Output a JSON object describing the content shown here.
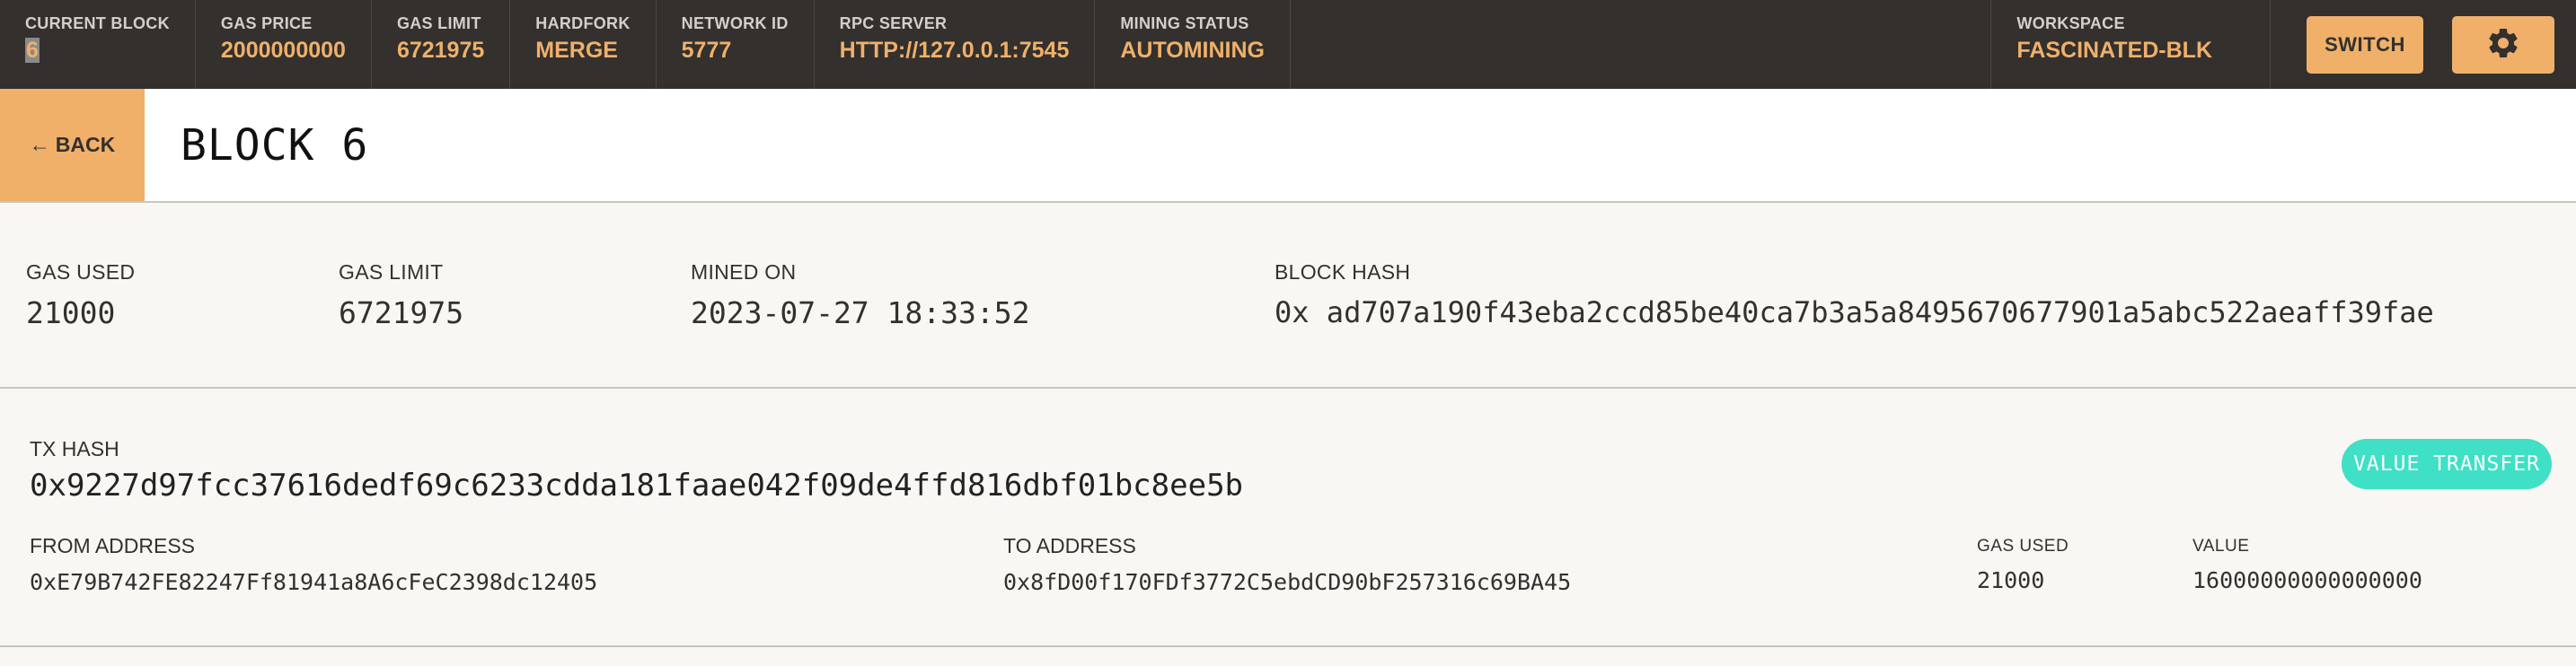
{
  "topbar": {
    "current_block": {
      "label": "CURRENT BLOCK",
      "value": "6"
    },
    "gas_price": {
      "label": "GAS PRICE",
      "value": "2000000000"
    },
    "gas_limit": {
      "label": "GAS LIMIT",
      "value": "6721975"
    },
    "hardfork": {
      "label": "HARDFORK",
      "value": "MERGE"
    },
    "network_id": {
      "label": "NETWORK ID",
      "value": "5777"
    },
    "rpc_server": {
      "label": "RPC SERVER",
      "value": "HTTP://127.0.0.1:7545"
    },
    "mining_status": {
      "label": "MINING STATUS",
      "value": "AUTOMINING"
    },
    "workspace": {
      "label": "WORKSPACE",
      "value": "FASCINATED-BLK"
    },
    "switch_label": "SWITCH",
    "settings_icon": "gear-icon"
  },
  "block_header": {
    "back_label": "BACK",
    "back_icon": "left-arrow-icon",
    "title": "BLOCK 6"
  },
  "block_info": {
    "gas_used": {
      "label": "GAS USED",
      "value": "21000"
    },
    "gas_limit": {
      "label": "GAS LIMIT",
      "value": "6721975"
    },
    "mined_on": {
      "label": "MINED ON",
      "value": "2023-07-27 18:33:52"
    },
    "block_hash": {
      "label": "BLOCK HASH",
      "value": "0x ad707a190f43eba2ccd85be40ca7b3a5a8495670677901a5abc522aeaff39fae"
    }
  },
  "transactions": [
    {
      "hash_label": "TX HASH",
      "hash": "0x9227d97fcc37616dedf69c6233cdda181faae042f09de4ffd816dbf01bc8ee5b",
      "type_badge": "VALUE TRANSFER",
      "from": {
        "label": "FROM ADDRESS",
        "value": "0xE79B742FE82247Ff81941a8A6cFeC2398dc12405"
      },
      "to": {
        "label": "TO ADDRESS",
        "value": "0x8fD00f170FDf3772C5ebdCD90bF257316c69BA45"
      },
      "gas_used": {
        "label": "GAS USED",
        "value": "21000"
      },
      "value": {
        "label": "VALUE",
        "value": "16000000000000000"
      }
    }
  ],
  "colors": {
    "topbar_bg": "#33302e",
    "accent": "#f0b06a",
    "badge": "#3fe0c5",
    "page_bg": "#f8f7f3"
  }
}
